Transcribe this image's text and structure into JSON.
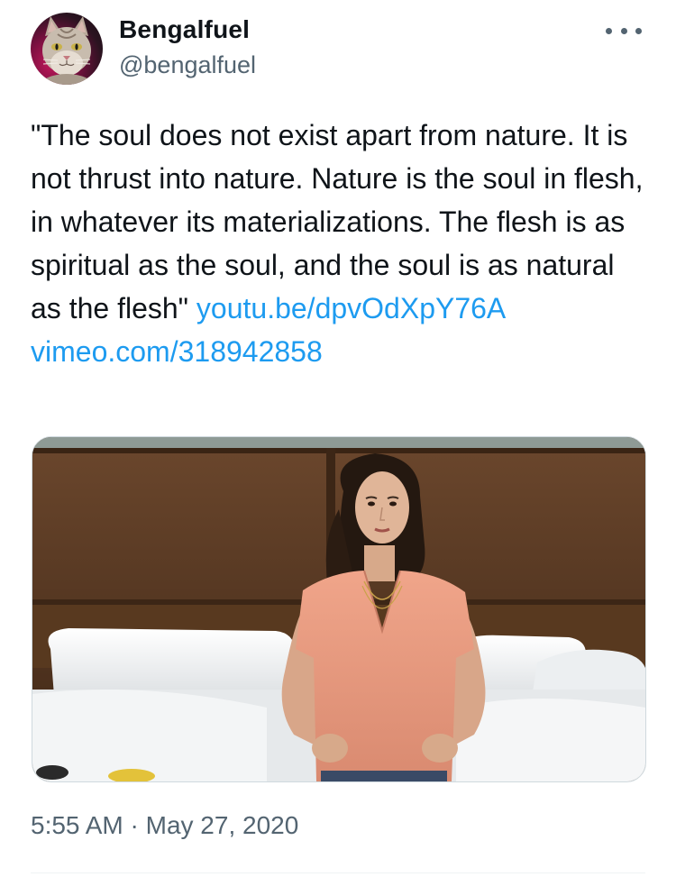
{
  "author": {
    "display_name": "Bengalfuel",
    "handle": "@bengalfuel",
    "avatar_icon": "cat-avatar-icon"
  },
  "menu": {
    "icon": "more-horizontal-icon"
  },
  "tweet": {
    "text": "\"The soul does not exist apart from nature. It is not thrust into nature. Nature is the soul in flesh, in whatever its materializations. The flesh is as spiritual as the soul, and the soul is as natural as the flesh\" ",
    "links": [
      {
        "label": "youtu.be/dpvOdXpY76A"
      },
      {
        "label": "vimeo.com/318942858"
      }
    ]
  },
  "media": {
    "type": "photo"
  },
  "meta": {
    "time": "5:55 AM",
    "separator": "·",
    "date": "May 27, 2020"
  },
  "colors": {
    "text": "#0f1419",
    "secondary": "#536471",
    "link": "#1d9bf0"
  }
}
